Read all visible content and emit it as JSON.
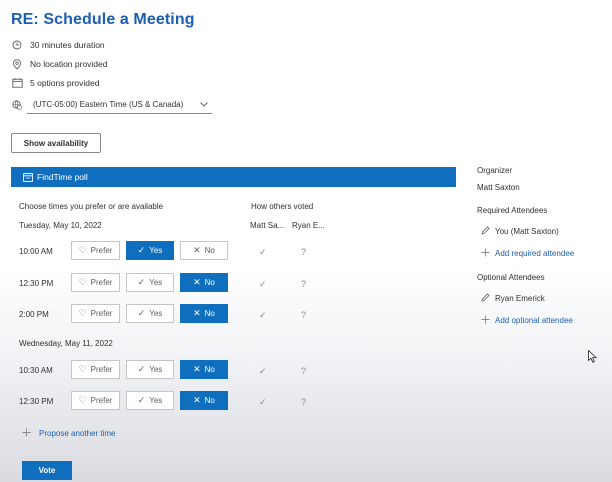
{
  "title": "RE: Schedule a Meeting",
  "meta": {
    "duration": "30 minutes duration",
    "location": "No location provided",
    "options": "5 options provided",
    "timezone": "(UTC-05:00) Eastern Time (US & Canada)"
  },
  "show_availability_label": "Show availability",
  "poll": {
    "header": "FindTime poll",
    "choose_label": "Choose times you prefer or are available",
    "others_label": "How others voted",
    "voters": [
      "Matt Sa...",
      "Ryan E..."
    ],
    "button_labels": {
      "prefer": "Prefer",
      "yes": "Yes",
      "no": "No"
    },
    "days": [
      {
        "date": "Tuesday, May 10, 2022",
        "slots": [
          {
            "time": "10:00 AM",
            "selected": "yes",
            "votes": [
              "✓",
              "?"
            ]
          },
          {
            "time": "12:30 PM",
            "selected": "no",
            "votes": [
              "✓",
              "?"
            ]
          },
          {
            "time": "2:00 PM",
            "selected": "no",
            "votes": [
              "✓",
              "?"
            ]
          }
        ]
      },
      {
        "date": "Wednesday, May 11, 2022",
        "slots": [
          {
            "time": "10:30 AM",
            "selected": "no",
            "votes": [
              "✓",
              "?"
            ]
          },
          {
            "time": "12:30 PM",
            "selected": "no",
            "votes": [
              "✓",
              "?"
            ]
          }
        ]
      }
    ],
    "propose_label": "Propose another time",
    "vote_label": "Vote"
  },
  "sidebar": {
    "organizer_head": "Organizer",
    "organizer": "Matt Saxton",
    "required_head": "Required Attendees",
    "required": [
      "You (Matt Saxton)"
    ],
    "add_required": "Add required attendee",
    "optional_head": "Optional Attendees",
    "optional": [
      "Ryan Emerick"
    ],
    "add_optional": "Add optional attendee"
  },
  "colors": {
    "accent": "#106ebe",
    "title": "#1a5fb4"
  }
}
